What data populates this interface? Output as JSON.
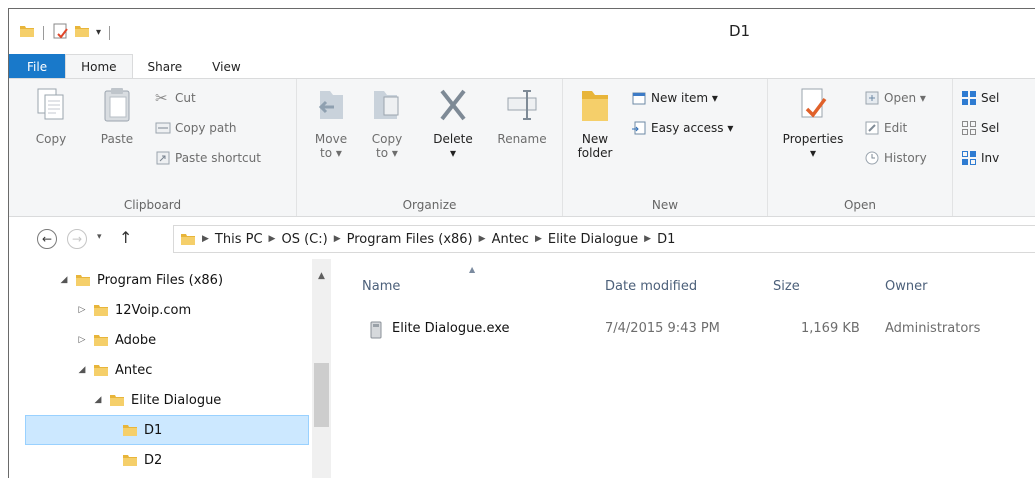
{
  "window": {
    "title": "D1"
  },
  "tabs": [
    {
      "label": "File"
    },
    {
      "label": "Home"
    },
    {
      "label": "Share"
    },
    {
      "label": "View"
    }
  ],
  "ribbon": {
    "clipboard": {
      "copy": "Copy",
      "paste": "Paste",
      "cut": "Cut",
      "copy_path": "Copy path",
      "paste_shortcut": "Paste shortcut",
      "label": "Clipboard"
    },
    "organize": {
      "move_to_line1": "Move",
      "move_to_line2": "to ▾",
      "copy_to_line1": "Copy",
      "copy_to_line2": "to ▾",
      "delete": "Delete",
      "delete_dd": "▾",
      "rename": "Rename",
      "label": "Organize"
    },
    "new": {
      "new_folder_line1": "New",
      "new_folder_line2": "folder",
      "new_item": "New item ▾",
      "easy_access": "Easy access ▾",
      "label": "New"
    },
    "open": {
      "properties": "Properties",
      "properties_dd": "▾",
      "open": "Open ▾",
      "edit": "Edit",
      "history": "History",
      "label": "Open"
    },
    "select": {
      "select_all": "Sel",
      "select_none": "Sel",
      "invert": "Inv"
    }
  },
  "address": {
    "crumbs": [
      "This PC",
      "OS (C:)",
      "Program Files (x86)",
      "Antec",
      "Elite Dialogue",
      "D1"
    ]
  },
  "tree": {
    "items": [
      {
        "label": "Program Files (x86)",
        "arrow": "◢"
      },
      {
        "label": "12Voip.com",
        "arrow": "▷"
      },
      {
        "label": "Adobe",
        "arrow": "▷"
      },
      {
        "label": "Antec",
        "arrow": "◢"
      },
      {
        "label": "Elite Dialogue",
        "arrow": "◢"
      },
      {
        "label": "D1",
        "arrow": ""
      },
      {
        "label": "D2",
        "arrow": ""
      }
    ]
  },
  "filelist": {
    "columns": {
      "name": "Name",
      "date": "Date modified",
      "size": "Size",
      "owner": "Owner"
    },
    "rows": [
      {
        "name": "Elite Dialogue.exe",
        "date": "7/4/2015 9:43 PM",
        "size": "1,169 KB",
        "owner": "Administrators"
      }
    ]
  },
  "colors": {
    "file_tab": "#1979ca",
    "selection": "#cce8ff",
    "folder": "#e8b53a"
  }
}
